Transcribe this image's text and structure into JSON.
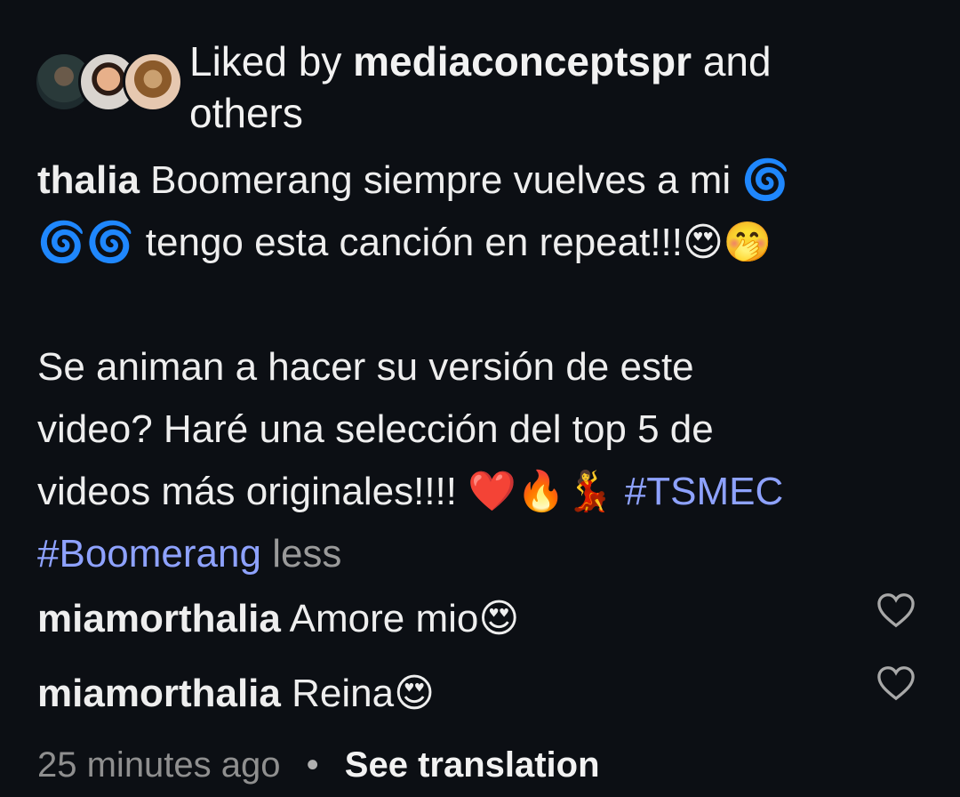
{
  "likes": {
    "prefix": "Liked by",
    "user": "mediaconceptspr",
    "suffix": "and",
    "tail": "others"
  },
  "caption": {
    "author": "thalia",
    "line1": "Boomerang siempre vuelves a mi 🌀",
    "line2": "🌀🌀 tengo esta canción en repeat!!!😍🤭",
    "line3": "Se animan a hacer su versión de este",
    "line4": "video? Haré una selección del top 5 de",
    "line5_text": "videos más originales!!!! ❤️🔥💃",
    "hashtag1": "#TSMEC",
    "hashtag2": "#Boomerang",
    "less_label": "less"
  },
  "comments": [
    {
      "user": "miamorthalia",
      "text": "Amore mio😍"
    },
    {
      "user": "miamorthalia",
      "text": "Reina😍"
    }
  ],
  "footer": {
    "time": "25 minutes ago",
    "separator": "•",
    "see_translation": "See translation"
  },
  "colors": {
    "background": "#0c0f14",
    "hashtag": "#8ea2ff",
    "muted": "#8f8f8f"
  },
  "icons": [
    "heart-outline-icon"
  ]
}
